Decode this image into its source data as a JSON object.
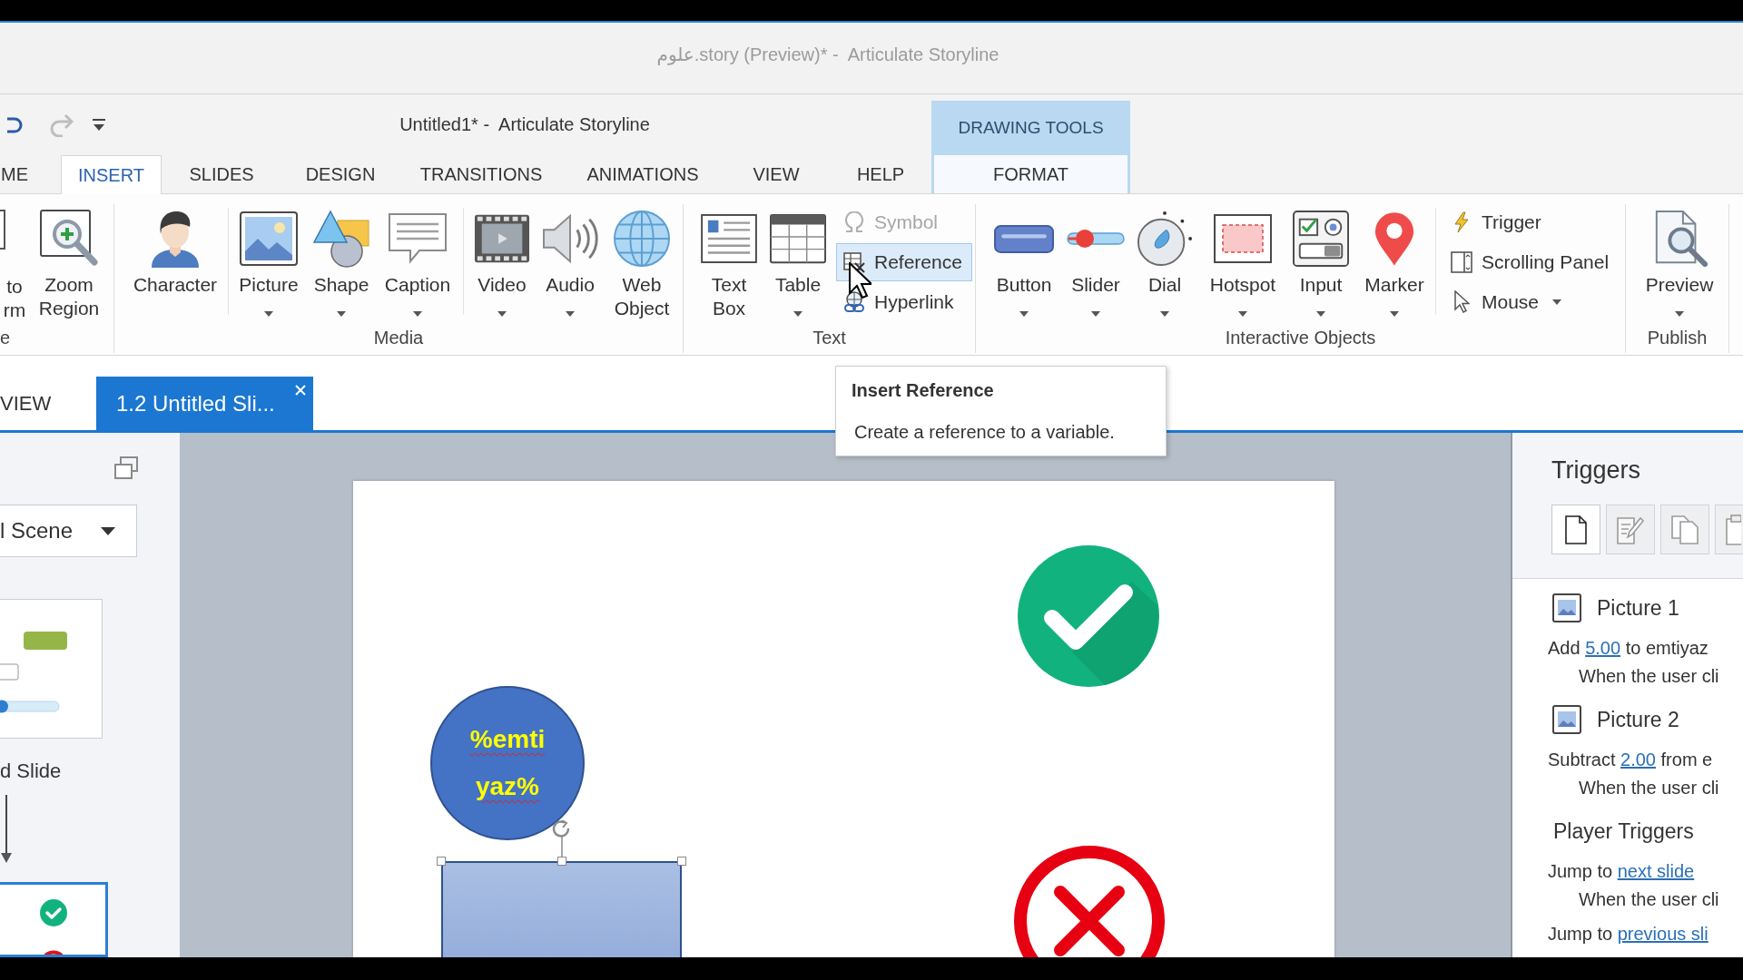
{
  "preview_window": {
    "title": "علوم.story (Preview)* -  Articulate Storyline"
  },
  "window": {
    "title": "Untitled1* -  Articulate Storyline",
    "contextual_group": "DRAWING TOOLS"
  },
  "quick_access": [
    {
      "kind": "undo",
      "disabled": false
    },
    {
      "kind": "redo",
      "disabled": true
    },
    {
      "kind": "customize",
      "disabled": false
    }
  ],
  "ribbon_tabs": [
    {
      "label": "ME",
      "selected": false,
      "contextual": false
    },
    {
      "label": "INSERT",
      "selected": true,
      "contextual": false
    },
    {
      "label": "SLIDES",
      "selected": false,
      "contextual": false
    },
    {
      "label": "DESIGN",
      "selected": false,
      "contextual": false
    },
    {
      "label": "TRANSITIONS",
      "selected": false,
      "contextual": false
    },
    {
      "label": "ANIMATIONS",
      "selected": false,
      "contextual": false
    },
    {
      "label": "VIEW",
      "selected": false,
      "contextual": false
    },
    {
      "label": "HELP",
      "selected": false,
      "contextual": false
    },
    {
      "label": "FORMAT",
      "selected": false,
      "contextual": true
    }
  ],
  "ribbon_groups": [
    {
      "label": "e",
      "sections": [
        [
          {
            "kind": "large",
            "label": "to rm",
            "dropdown": false
          },
          {
            "kind": "large",
            "label": "Zoom Region",
            "dropdown": false
          }
        ]
      ]
    },
    {
      "label": "Media",
      "sections": [
        [
          {
            "kind": "large",
            "label": "Character",
            "dropdown": false
          }
        ],
        [
          {
            "kind": "large",
            "label": "Picture",
            "dropdown": true
          },
          {
            "kind": "large",
            "label": "Shape",
            "dropdown": true
          },
          {
            "kind": "large",
            "label": "Caption",
            "dropdown": true
          }
        ],
        [
          {
            "kind": "large",
            "label": "Video",
            "dropdown": true
          },
          {
            "kind": "large",
            "label": "Audio",
            "dropdown": true
          },
          {
            "kind": "large",
            "label": "Web Object",
            "dropdown": false
          }
        ]
      ]
    },
    {
      "label": "Text",
      "sections": [
        [
          {
            "kind": "large",
            "label": "Text Box",
            "dropdown": false
          },
          {
            "kind": "large",
            "label": "Table",
            "dropdown": true
          },
          {
            "kind": "stack",
            "items": [
              {
                "label": "Symbol",
                "disabled": true,
                "highlighted": false,
                "dropdown": false
              },
              {
                "label": "Reference",
                "disabled": false,
                "highlighted": true,
                "dropdown": false
              },
              {
                "label": "Hyperlink",
                "disabled": false,
                "highlighted": false,
                "dropdown": false
              }
            ]
          }
        ]
      ]
    },
    {
      "label": "Interactive Objects",
      "sections": [
        [
          {
            "kind": "large",
            "label": "Button",
            "dropdown": true
          },
          {
            "kind": "large",
            "label": "Slider",
            "dropdown": true
          },
          {
            "kind": "large",
            "label": "Dial",
            "dropdown": true
          },
          {
            "kind": "large",
            "label": "Hotspot",
            "dropdown": true
          },
          {
            "kind": "large",
            "label": "Input",
            "dropdown": true
          },
          {
            "kind": "large",
            "label": "Marker",
            "dropdown": true
          }
        ],
        [
          {
            "kind": "stack",
            "items": [
              {
                "label": "Trigger",
                "disabled": false,
                "highlighted": false,
                "dropdown": false
              },
              {
                "label": "Scrolling Panel",
                "disabled": false,
                "highlighted": false,
                "dropdown": false
              },
              {
                "label": "Mouse",
                "disabled": false,
                "highlighted": false,
                "dropdown": true
              }
            ]
          }
        ]
      ]
    },
    {
      "label": "Publish",
      "sections": [
        [
          {
            "kind": "large",
            "label": "Preview",
            "dropdown": true
          }
        ]
      ]
    }
  ],
  "document_tabs": [
    {
      "label": "VIEW",
      "selected": false,
      "closable": false
    },
    {
      "label": "1.2 Untitled Sli...",
      "selected": true,
      "closable": true
    }
  ],
  "tooltip": {
    "title": "Insert Reference",
    "text": "Create a reference to a variable."
  },
  "scene_panel": {
    "scene": "l Scene",
    "slides": [
      {
        "kind": "form",
        "label": "d Slide",
        "selected": false
      },
      {
        "kind": "feedback",
        "selected": true
      }
    ]
  },
  "slide": {
    "objects": [
      {
        "kind": "oval",
        "text": "%emti yaz%",
        "selected": false
      },
      {
        "kind": "rectangle",
        "selected": true
      },
      {
        "kind": "check_picture",
        "selected": false
      },
      {
        "kind": "cross_picture",
        "selected": false
      }
    ]
  },
  "triggers_panel": {
    "title": "Triggers",
    "toolbar": [
      {
        "kind": "new",
        "disabled": false
      },
      {
        "kind": "edit",
        "disabled": true
      },
      {
        "kind": "copy",
        "disabled": true
      },
      {
        "kind": "paste",
        "disabled": true
      }
    ],
    "sections": [
      {
        "kind": "object",
        "title": "Picture 1",
        "triggers": [
          {
            "parts": [
              {
                "text": "Add ",
                "link": false
              },
              {
                "text": "5.00",
                "link": true
              },
              {
                "text": " to emtiyaz",
                "link": false
              }
            ],
            "condition": "When the user cli"
          }
        ]
      },
      {
        "kind": "object",
        "title": "Picture 2",
        "triggers": [
          {
            "parts": [
              {
                "text": "Subtract ",
                "link": false
              },
              {
                "text": "2.00",
                "link": true
              },
              {
                "text": " from e",
                "link": false
              }
            ],
            "condition": "When the user cli"
          }
        ]
      },
      {
        "kind": "player",
        "title": "Player Triggers",
        "triggers": [
          {
            "parts": [
              {
                "text": "Jump to ",
                "link": false
              },
              {
                "text": "next slide",
                "link": true
              }
            ],
            "condition": "When the user cli"
          },
          {
            "parts": [
              {
                "text": "Jump to ",
                "link": false
              },
              {
                "text": "previous sli",
                "link": true
              }
            ]
          }
        ]
      }
    ]
  }
}
